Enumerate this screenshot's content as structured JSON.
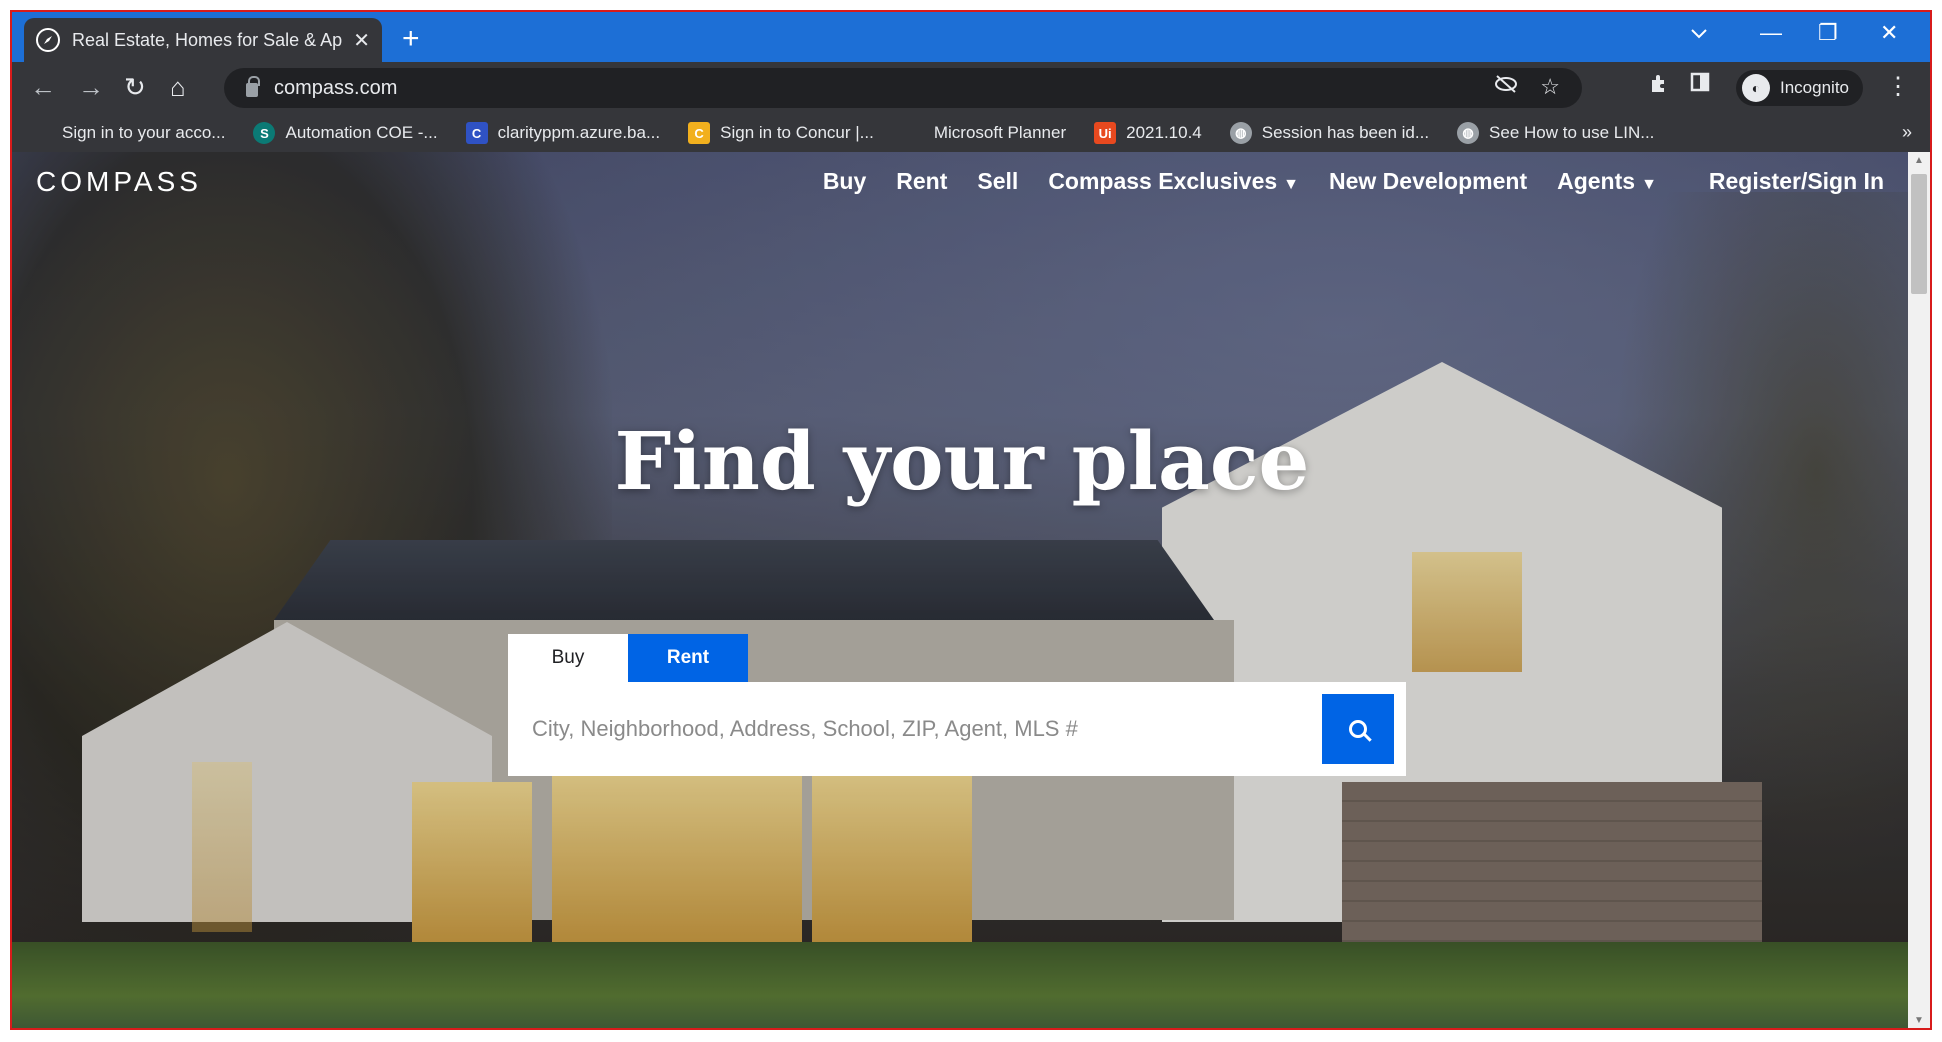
{
  "browser": {
    "tab_title": "Real Estate, Homes for Sale & Ap",
    "new_tab_icon": "plus-icon",
    "url": "compass.com",
    "profile_label": "Incognito",
    "bookmarks": [
      {
        "label": "Sign in to your acco...",
        "icon": "microsoft-icon"
      },
      {
        "label": "Automation COE -...",
        "icon": "sharepoint-icon"
      },
      {
        "label": "clarityppm.azure.ba...",
        "icon": "clarity-icon"
      },
      {
        "label": "Sign in to Concur |...",
        "icon": "concur-icon"
      },
      {
        "label": "Microsoft Planner",
        "icon": "microsoft-icon"
      },
      {
        "label": "2021.10.4",
        "icon": "uipath-icon"
      },
      {
        "label": "Session has been id...",
        "icon": "globe-icon"
      },
      {
        "label": "See How to use LIN...",
        "icon": "globe-icon"
      }
    ],
    "more_bookmarks": "»"
  },
  "site": {
    "logo": "COMPASS",
    "nav": {
      "buy": "Buy",
      "rent": "Rent",
      "sell": "Sell",
      "exclusives": "Compass Exclusives",
      "new_dev": "New Development",
      "agents": "Agents",
      "register": "Register/Sign In"
    },
    "headline": "Find your place",
    "search": {
      "tab_buy": "Buy",
      "tab_rent": "Rent",
      "active_tab": "Rent",
      "placeholder": "City, Neighborhood, Address, School, ZIP, Agent, MLS #",
      "value": ""
    },
    "colors": {
      "accent": "#0064e5",
      "browser_tabstrip": "#1d6fd6"
    }
  }
}
